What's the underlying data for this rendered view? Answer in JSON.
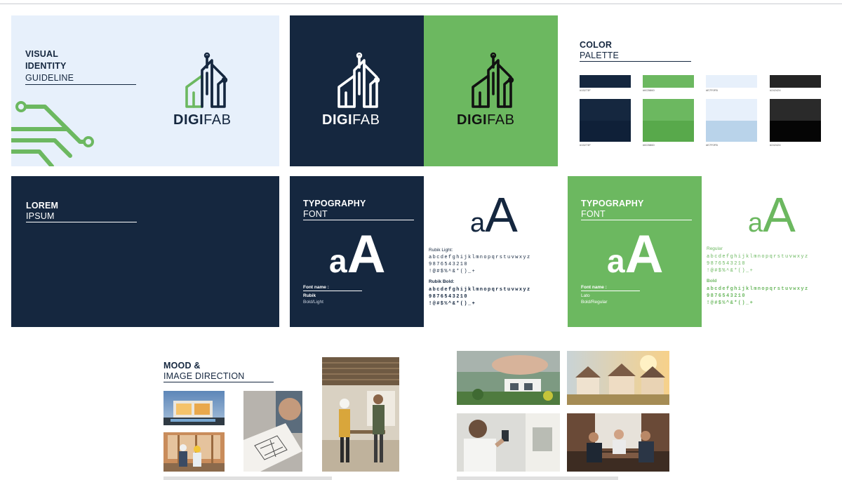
{
  "colors": {
    "navy": "#15273f",
    "green": "#6cb860",
    "light_blue": "#e7f0fb",
    "dark": "#242424"
  },
  "cover": {
    "title_line1": "VISUAL",
    "title_line2": "IDENTITY",
    "subtitle": "GUIDELINE"
  },
  "logo": {
    "bold": "DIGI",
    "light": "FAB",
    "icon": "building-circuit-icon"
  },
  "palette": {
    "title": "COLOR",
    "subtitle": "PALETTE",
    "small_swatches": [
      {
        "color": "#15273f",
        "code": "#15273F"
      },
      {
        "color": "#6cb860",
        "code": "#6CB860"
      },
      {
        "color": "#e7f0fb",
        "code": "#E7F0FB"
      },
      {
        "color": "#242424",
        "code": "#242424"
      }
    ],
    "large_swatches": [
      {
        "top": "#15273f",
        "bottom": "#0f2038",
        "code": "#15273F"
      },
      {
        "top": "#6cb860",
        "bottom": "#58a94b",
        "code": "#6CB860"
      },
      {
        "top": "#e7f0fb",
        "bottom": "#b9d3ea",
        "code": "#E7F0FB"
      },
      {
        "top": "#2a2a2a",
        "bottom": "#050505",
        "code": "#242424"
      }
    ]
  },
  "lorem": {
    "title": "LOREM",
    "subtitle": "IPSUM"
  },
  "typo1": {
    "title": "TYPOGRAPHY",
    "subtitle": "FONT",
    "sample_light": "a",
    "sample_bold": "A",
    "font_name_label": "Font name :",
    "font_name": "Rubik",
    "weights": "Bold/Light",
    "light_label": "Rubik Light:",
    "light_lower": "abcdefghijklmnopqrstuvwxyz",
    "light_digits": "9876543210",
    "light_symbols": "!@#$%^&*()_+",
    "bold_label": "Rubik Bold:",
    "bold_lower": "abcdefghijklmnopqrstuvwxyz",
    "bold_digits": "9876543210",
    "bold_symbols": "!@#$%^&*()_+"
  },
  "typo2": {
    "title": "TYPOGRAPHY",
    "subtitle": "FONT",
    "sample_light": "a",
    "sample_bold": "A",
    "font_name_label": "Font name :",
    "font_name": "Lato",
    "weights": "Bold/Regular",
    "regular_label": "Regular",
    "regular_lower": "abcdefghijklmnopqrstuvwxyz",
    "regular_digits": "9876543210",
    "regular_symbols": "!@#$%^&*()_+",
    "bold_label": "Bold",
    "bold_lower": "abcdefghijklmnopqrstuvwxyz",
    "bold_digits": "9876543210",
    "bold_symbols": "!@#$%^&*()_+"
  },
  "mood": {
    "title": "MOOD &",
    "subtitle": "IMAGE DIRECTION",
    "photos_left": [
      "modern-house-photo",
      "construction-workers-photo",
      "blueprint-review-photo",
      "site-engineers-photo"
    ],
    "photos_right": [
      "architect-model-photo",
      "houses-sunset-photo",
      "smart-thermostat-photo",
      "business-meeting-photo"
    ]
  }
}
